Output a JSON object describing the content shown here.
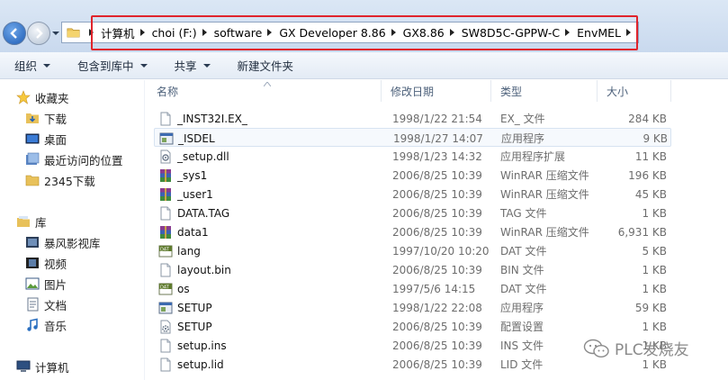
{
  "address_bar": {
    "crumbs": [
      "计算机",
      "choi (F:)",
      "software",
      "GX Developer 8.86",
      "GX8.86",
      "SW8D5C-GPPW-C",
      "EnvMEL"
    ]
  },
  "toolbar": {
    "organize": "组织",
    "include_library": "包含到库中",
    "share": "共享",
    "new_folder": "新建文件夹"
  },
  "nav": {
    "favorites": "收藏夹",
    "downloads": "下载",
    "desktop": "桌面",
    "recent": "最近访问的位置",
    "dl2345": "2345下载",
    "libraries": "库",
    "storm": "暴风影视库",
    "videos": "视频",
    "pictures": "图片",
    "documents": "文档",
    "music": "音乐",
    "computer": "计算机"
  },
  "columns": {
    "name": "名称",
    "date": "修改日期",
    "type": "类型",
    "size": "大小"
  },
  "files": [
    {
      "name": "_INST32I.EX_",
      "date": "1998/1/22 21:54",
      "type": "EX_ 文件",
      "size": "284 KB",
      "icon": "blank-file-icon"
    },
    {
      "name": "_ISDEL",
      "date": "1998/1/27 14:07",
      "type": "应用程序",
      "size": "9 KB",
      "icon": "application-icon"
    },
    {
      "name": "_setup.dll",
      "date": "1998/1/23 14:32",
      "type": "应用程序扩展",
      "size": "11 KB",
      "icon": "dll-icon"
    },
    {
      "name": "_sys1",
      "date": "2006/8/25 10:39",
      "type": "WinRAR 压缩文件",
      "size": "196 KB",
      "icon": "winrar-icon"
    },
    {
      "name": "_user1",
      "date": "2006/8/25 10:39",
      "type": "WinRAR 压缩文件",
      "size": "45 KB",
      "icon": "winrar-icon"
    },
    {
      "name": "DATA.TAG",
      "date": "2006/8/25 10:39",
      "type": "TAG 文件",
      "size": "1 KB",
      "icon": "blank-file-icon"
    },
    {
      "name": "data1",
      "date": "2006/8/25 10:39",
      "type": "WinRAR 压缩文件",
      "size": "6,931 KB",
      "icon": "winrar-icon"
    },
    {
      "name": "lang",
      "date": "1997/10/20 10:20",
      "type": "DAT 文件",
      "size": "5 KB",
      "icon": "dat-icon"
    },
    {
      "name": "layout.bin",
      "date": "2006/8/25 10:39",
      "type": "BIN 文件",
      "size": "1 KB",
      "icon": "blank-file-icon"
    },
    {
      "name": "os",
      "date": "1997/5/6 14:15",
      "type": "DAT 文件",
      "size": "1 KB",
      "icon": "dat-icon"
    },
    {
      "name": "SETUP",
      "date": "1998/1/22 22:08",
      "type": "应用程序",
      "size": "59 KB",
      "icon": "application-icon"
    },
    {
      "name": "SETUP",
      "date": "2006/8/25 10:39",
      "type": "配置设置",
      "size": "1 KB",
      "icon": "config-icon"
    },
    {
      "name": "setup.ins",
      "date": "2006/8/25 10:39",
      "type": "INS 文件",
      "size": "1 KB",
      "icon": "blank-file-icon"
    },
    {
      "name": "setup.lid",
      "date": "2006/8/25 10:39",
      "type": "LID 文件",
      "size": "1 KB",
      "icon": "blank-file-icon"
    }
  ],
  "watermark": "PLC发烧友",
  "colors": {
    "highlight_box": "#e0242c",
    "selection_border": "#d7e3f1"
  }
}
